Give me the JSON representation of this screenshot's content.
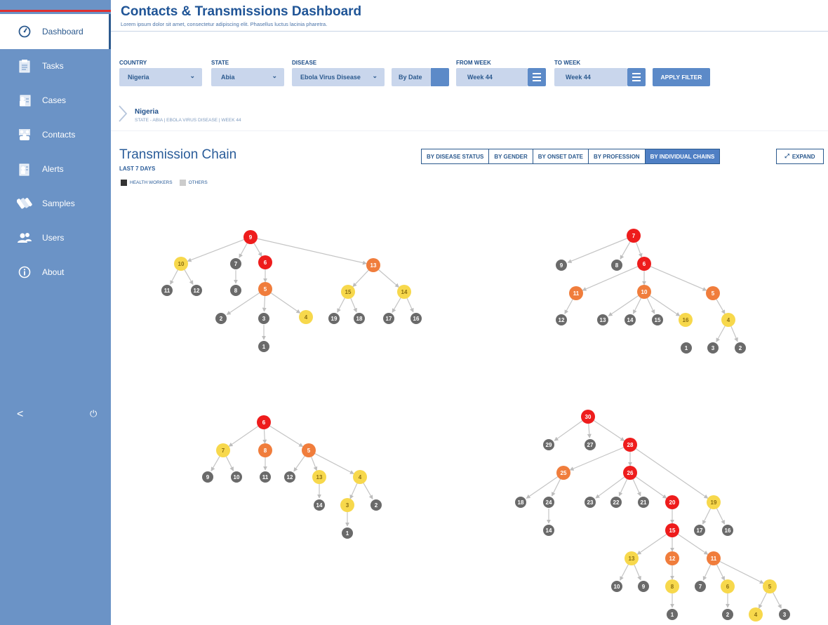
{
  "sidebar": {
    "items": [
      {
        "label": "Dashboard",
        "icon": "dashboard-gauge-icon",
        "active": true
      },
      {
        "label": "Tasks",
        "icon": "tasks-clipboard-icon"
      },
      {
        "label": "Cases",
        "icon": "cases-icon"
      },
      {
        "label": "Contacts",
        "icon": "contacts-group-icon"
      },
      {
        "label": "Alerts",
        "icon": "alerts-icon"
      },
      {
        "label": "Samples",
        "icon": "samples-test-tube-icon"
      },
      {
        "label": "Users",
        "icon": "users-icon"
      },
      {
        "label": "About",
        "icon": "info-icon"
      }
    ],
    "collapse_glyph": "<",
    "power_glyph": "⏻"
  },
  "header": {
    "title": "Contacts & Transmissions Dashboard",
    "subtitle": "Lorem ipsum dolor sit amet, consectetur adipiscing elit. Phasellus luctus lacinia pharetra."
  },
  "filters": {
    "country": {
      "label": "COUNTRY",
      "value": "Nigeria"
    },
    "state": {
      "label": "STATE",
      "value": "Abia"
    },
    "disease": {
      "label": "DISEASE",
      "value": "Ebola Virus Disease"
    },
    "by_date": "By Date",
    "from_week": {
      "label": "FROM WEEK",
      "value": "Week 44"
    },
    "to_week": {
      "label": "TO WEEK",
      "value": "Week 44"
    },
    "apply": "APPLY FILTER"
  },
  "breadcrumb": {
    "title": "Nigeria",
    "sub": "STATE - ABIA | EBOLA VIRUS DISEASE | WEEK 44"
  },
  "transmission": {
    "title": "Transmission Chain",
    "period": "LAST 7 DAYS",
    "legend": [
      {
        "label": "HEALTH WORKERS",
        "color": "#333333"
      },
      {
        "label": "OTHERS",
        "color": "#cccccc"
      }
    ],
    "tabs": [
      "BY DISEASE STATUS",
      "BY GENDER",
      "BY ONSET DATE",
      "BY PROFESSION",
      "BY INDIVIDUAL CHAINS"
    ],
    "active_tab": "BY INDIVIDUAL CHAINS",
    "expand": "EXPAND"
  },
  "colors": {
    "red": "#ee1c1c",
    "orange": "#f07d3c",
    "yellow": "#f7d84c",
    "gray": "#6a6a6a",
    "sidebar": "#6b93c6",
    "accent": "#5c8ac8"
  },
  "chains": [
    {
      "nodes": [
        {
          "id": "9",
          "c": "red"
        },
        {
          "id": "10",
          "c": "yellow"
        },
        {
          "id": "7",
          "c": "gray"
        },
        {
          "id": "6",
          "c": "red"
        },
        {
          "id": "13",
          "c": "orange"
        },
        {
          "id": "11",
          "c": "gray"
        },
        {
          "id": "12",
          "c": "gray"
        },
        {
          "id": "8",
          "c": "gray"
        },
        {
          "id": "5",
          "c": "orange"
        },
        {
          "id": "15",
          "c": "yellow"
        },
        {
          "id": "14",
          "c": "yellow"
        },
        {
          "id": "2",
          "c": "gray"
        },
        {
          "id": "3",
          "c": "gray"
        },
        {
          "id": "4",
          "c": "yellow"
        },
        {
          "id": "1",
          "c": "gray"
        },
        {
          "id": "19",
          "c": "gray"
        },
        {
          "id": "18",
          "c": "gray"
        },
        {
          "id": "17",
          "c": "gray"
        },
        {
          "id": "16",
          "c": "gray"
        }
      ],
      "edges": [
        [
          "9",
          "10"
        ],
        [
          "9",
          "7"
        ],
        [
          "9",
          "6"
        ],
        [
          "9",
          "13"
        ],
        [
          "10",
          "11"
        ],
        [
          "10",
          "12"
        ],
        [
          "7",
          "8"
        ],
        [
          "6",
          "5"
        ],
        [
          "5",
          "2"
        ],
        [
          "5",
          "3"
        ],
        [
          "5",
          "4"
        ],
        [
          "3",
          "1"
        ],
        [
          "13",
          "15"
        ],
        [
          "13",
          "14"
        ],
        [
          "15",
          "19"
        ],
        [
          "15",
          "18"
        ],
        [
          "14",
          "17"
        ],
        [
          "14",
          "16"
        ]
      ]
    },
    {
      "nodes": [
        {
          "id": "7",
          "c": "red"
        },
        {
          "id": "9",
          "c": "gray"
        },
        {
          "id": "8",
          "c": "gray"
        },
        {
          "id": "6",
          "c": "red"
        },
        {
          "id": "11",
          "c": "orange"
        },
        {
          "id": "10",
          "c": "orange"
        },
        {
          "id": "5",
          "c": "orange"
        },
        {
          "id": "12",
          "c": "gray"
        },
        {
          "id": "13",
          "c": "gray"
        },
        {
          "id": "14",
          "c": "gray"
        },
        {
          "id": "15",
          "c": "gray"
        },
        {
          "id": "16",
          "c": "yellow"
        },
        {
          "id": "4",
          "c": "yellow"
        },
        {
          "id": "1",
          "c": "gray"
        },
        {
          "id": "3",
          "c": "gray"
        },
        {
          "id": "2",
          "c": "gray"
        }
      ],
      "edges": [
        [
          "7",
          "9"
        ],
        [
          "7",
          "8"
        ],
        [
          "7",
          "6"
        ],
        [
          "6",
          "11"
        ],
        [
          "6",
          "10"
        ],
        [
          "6",
          "5"
        ],
        [
          "11",
          "12"
        ],
        [
          "10",
          "13"
        ],
        [
          "10",
          "14"
        ],
        [
          "10",
          "15"
        ],
        [
          "10",
          "16"
        ],
        [
          "5",
          "4"
        ],
        [
          "4",
          "3"
        ],
        [
          "4",
          "2"
        ]
      ]
    },
    {
      "nodes": [
        {
          "id": "6",
          "c": "red"
        },
        {
          "id": "7",
          "c": "yellow"
        },
        {
          "id": "8",
          "c": "orange"
        },
        {
          "id": "5",
          "c": "orange"
        },
        {
          "id": "9",
          "c": "gray"
        },
        {
          "id": "10",
          "c": "gray"
        },
        {
          "id": "11",
          "c": "gray"
        },
        {
          "id": "12",
          "c": "gray"
        },
        {
          "id": "13",
          "c": "yellow"
        },
        {
          "id": "4",
          "c": "yellow"
        },
        {
          "id": "14",
          "c": "gray"
        },
        {
          "id": "3",
          "c": "yellow"
        },
        {
          "id": "2",
          "c": "gray"
        },
        {
          "id": "1",
          "c": "gray"
        }
      ],
      "edges": [
        [
          "6",
          "7"
        ],
        [
          "6",
          "8"
        ],
        [
          "6",
          "5"
        ],
        [
          "7",
          "9"
        ],
        [
          "7",
          "10"
        ],
        [
          "8",
          "11"
        ],
        [
          "5",
          "12"
        ],
        [
          "5",
          "13"
        ],
        [
          "5",
          "4"
        ],
        [
          "13",
          "14"
        ],
        [
          "4",
          "3"
        ],
        [
          "4",
          "2"
        ],
        [
          "3",
          "1"
        ]
      ]
    },
    {
      "nodes": [
        {
          "id": "30",
          "c": "red"
        },
        {
          "id": "29",
          "c": "gray"
        },
        {
          "id": "27",
          "c": "gray"
        },
        {
          "id": "28",
          "c": "red"
        },
        {
          "id": "25",
          "c": "orange"
        },
        {
          "id": "26",
          "c": "red"
        },
        {
          "id": "19",
          "c": "yellow"
        },
        {
          "id": "18",
          "c": "gray"
        },
        {
          "id": "24",
          "c": "gray"
        },
        {
          "id": "14",
          "c": "gray"
        },
        {
          "id": "23",
          "c": "gray"
        },
        {
          "id": "22",
          "c": "gray"
        },
        {
          "id": "21",
          "c": "gray"
        },
        {
          "id": "20",
          "c": "red"
        },
        {
          "id": "17",
          "c": "gray"
        },
        {
          "id": "16",
          "c": "gray"
        },
        {
          "id": "15",
          "c": "red"
        },
        {
          "id": "13",
          "c": "yellow"
        },
        {
          "id": "12",
          "c": "orange"
        },
        {
          "id": "11",
          "c": "orange"
        },
        {
          "id": "10",
          "c": "gray"
        },
        {
          "id": "9",
          "c": "gray"
        },
        {
          "id": "8",
          "c": "yellow"
        },
        {
          "id": "7",
          "c": "gray"
        },
        {
          "id": "6",
          "c": "yellow"
        },
        {
          "id": "5",
          "c": "yellow"
        },
        {
          "id": "1",
          "c": "gray"
        },
        {
          "id": "2",
          "c": "gray"
        },
        {
          "id": "4",
          "c": "yellow"
        },
        {
          "id": "3",
          "c": "gray"
        }
      ],
      "edges": [
        [
          "30",
          "29"
        ],
        [
          "30",
          "27"
        ],
        [
          "30",
          "28"
        ],
        [
          "28",
          "25"
        ],
        [
          "28",
          "26"
        ],
        [
          "28",
          "19"
        ],
        [
          "25",
          "18"
        ],
        [
          "25",
          "24"
        ],
        [
          "24",
          "14"
        ],
        [
          "26",
          "23"
        ],
        [
          "26",
          "22"
        ],
        [
          "26",
          "21"
        ],
        [
          "26",
          "20"
        ],
        [
          "20",
          "15"
        ],
        [
          "19",
          "17"
        ],
        [
          "19",
          "16"
        ],
        [
          "15",
          "13"
        ],
        [
          "15",
          "12"
        ],
        [
          "15",
          "11"
        ],
        [
          "13",
          "10"
        ],
        [
          "13",
          "9"
        ],
        [
          "12",
          "8"
        ],
        [
          "8",
          "1"
        ],
        [
          "11",
          "7"
        ],
        [
          "11",
          "6"
        ],
        [
          "11",
          "5"
        ],
        [
          "6",
          "2"
        ],
        [
          "5",
          "4"
        ],
        [
          "5",
          "3"
        ]
      ]
    }
  ]
}
